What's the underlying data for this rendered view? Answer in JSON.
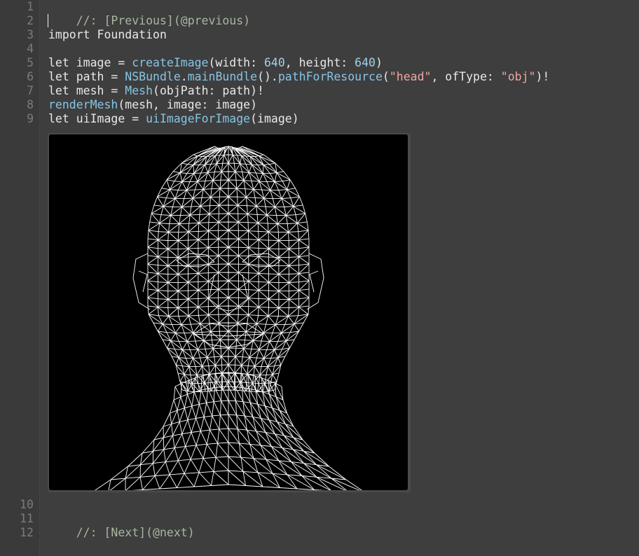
{
  "editor": {
    "background_color": "#3e3e3e",
    "line_number_color": "#7b7b7b",
    "line_numbers": [
      "1",
      "2",
      "3",
      "4",
      "5",
      "6",
      "7",
      "8",
      "9",
      "10",
      "11",
      "12"
    ],
    "lines": {
      "l1": {
        "text": "//: [Previous](@previous)"
      },
      "l3": {
        "kw": "import",
        "mod": " Foundation"
      },
      "l5": {
        "kw": "let",
        "a": " image = ",
        "fn": "createImage",
        "b": "(width: ",
        "n1": "640",
        "c": ", height: ",
        "n2": "640",
        "d": ")"
      },
      "l6": {
        "kw": "let",
        "a": " path = ",
        "typ": "NSBundle",
        "dot1": ".",
        "fn1": "mainBundle",
        "p1": "().",
        "fn2": "pathForResource",
        "p2": "(",
        "s1": "\"head\"",
        "p3": ", ofType: ",
        "s2": "\"obj\"",
        "p4": ")!"
      },
      "l7": {
        "kw": "let",
        "a": " mesh = ",
        "typ": "Mesh",
        "b": "(objPath: path)!"
      },
      "l8": {
        "fn": "renderMesh",
        "a": "(mesh, image: image)"
      },
      "l9": {
        "kw": "let",
        "a": " uiImage = ",
        "fn": "uiImageForImage",
        "b": "(image)"
      },
      "l11": {
        "text": "//: [Next](@next)"
      }
    }
  },
  "result_image": {
    "icon": "wireframe-head-image",
    "stroke_color": "#ffffff",
    "background_color": "#000000"
  }
}
